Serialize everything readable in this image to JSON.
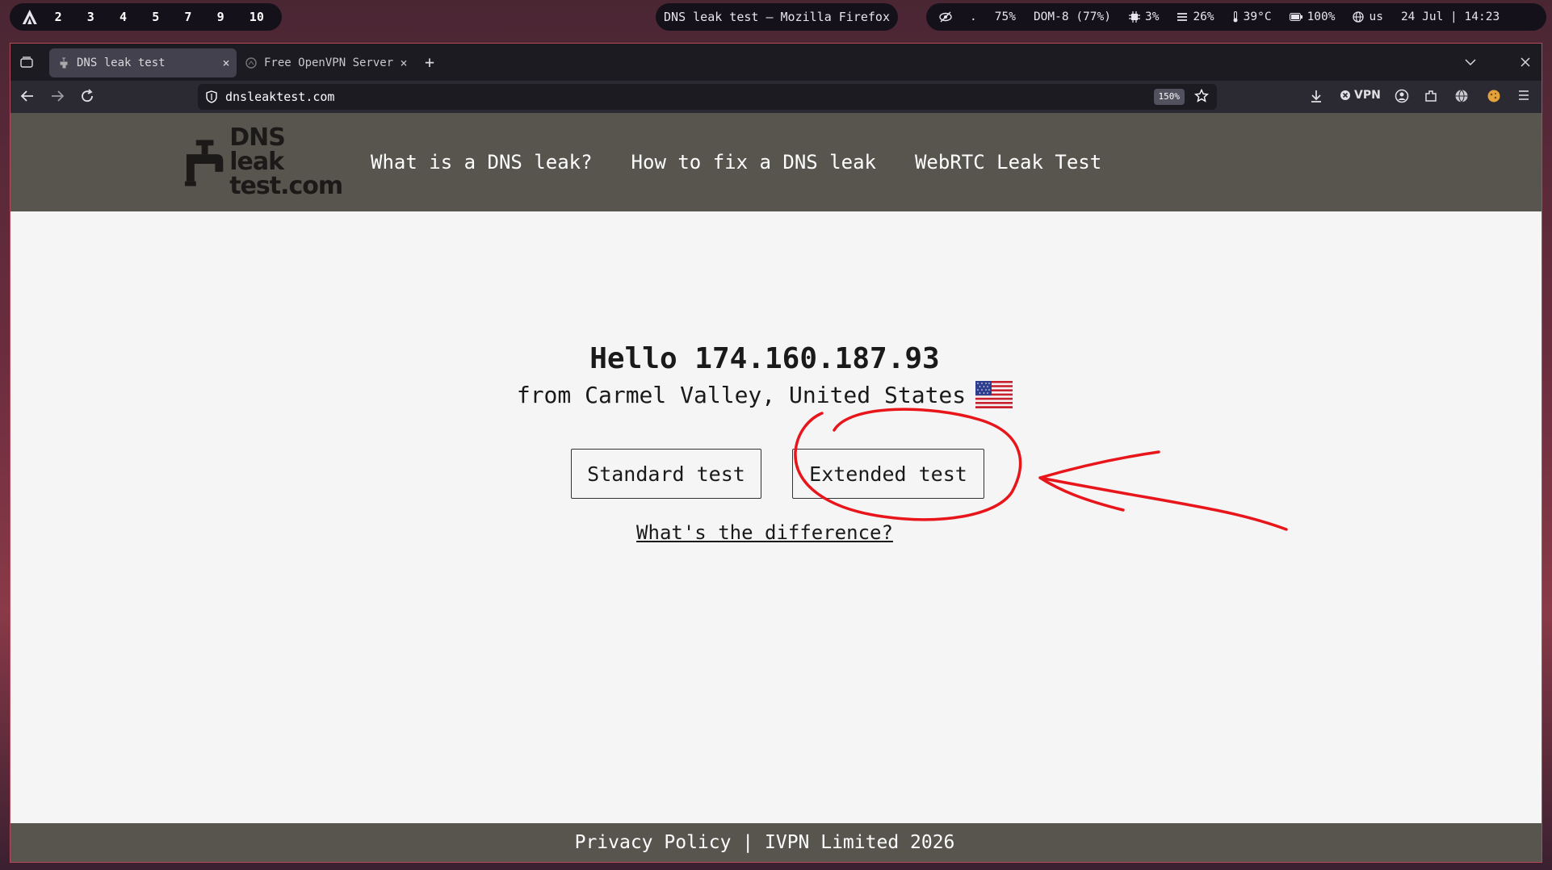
{
  "desktop": {
    "workspaces": [
      "2",
      "3",
      "4",
      "5",
      "7",
      "9",
      "10"
    ],
    "window_title": "DNS leak test — Mozilla Firefox",
    "status": {
      "net_dot": ".",
      "volume": "75%",
      "display": "DOM-8 (77%)",
      "cpu": "3%",
      "memory": "26%",
      "temp": "39°C",
      "battery": "100%",
      "keyboard": "us",
      "datetime": "24 Jul | 14:23"
    }
  },
  "browser": {
    "tabs": [
      {
        "title": "DNS leak test",
        "close": "×"
      },
      {
        "title": "Free OpenVPN Server",
        "close": "×"
      }
    ],
    "new_tab": "+",
    "url": "dnsleaktest.com",
    "zoom": "150%",
    "vpn_label": "VPN"
  },
  "site": {
    "logo_line1": "DNS leak",
    "logo_line2": "test.com",
    "nav": [
      "What is a DNS leak?",
      "How to fix a DNS leak",
      "WebRTC Leak Test"
    ],
    "hello": "Hello 174.160.187.93",
    "from": "from Carmel Valley, United States",
    "standard_button": "Standard test",
    "extended_button": "Extended test",
    "difference_link": "What's the difference?",
    "footer": "Privacy Policy | IVPN Limited 2026"
  },
  "colors": {
    "header_bg": "#58554f",
    "page_bg": "#f5f5f5",
    "annotation": "#e8151b"
  }
}
